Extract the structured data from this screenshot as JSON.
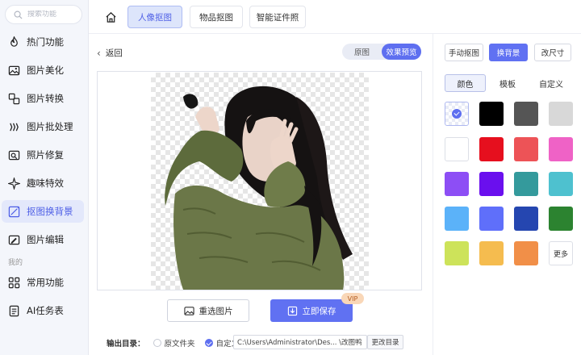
{
  "search": {
    "placeholder": "搜索功能"
  },
  "sidebar": {
    "items": [
      {
        "label": "热门功能",
        "icon": "flame-icon"
      },
      {
        "label": "图片美化",
        "icon": "image-icon"
      },
      {
        "label": "图片转换",
        "icon": "convert-icon"
      },
      {
        "label": "图片批处理",
        "icon": "batch-icon"
      },
      {
        "label": "照片修复",
        "icon": "repair-icon"
      },
      {
        "label": "趣味特效",
        "icon": "sparkle-icon"
      },
      {
        "label": "抠图换背景",
        "icon": "cutout-icon",
        "active": true
      },
      {
        "label": "图片编辑",
        "icon": "edit-icon"
      }
    ],
    "section_label": "我的",
    "my_items": [
      {
        "label": "常用功能",
        "icon": "grid-icon"
      },
      {
        "label": "AI任务表",
        "icon": "list-icon"
      }
    ]
  },
  "topbar": {
    "tabs": [
      {
        "label": "人像抠图",
        "active": true
      },
      {
        "label": "物品抠图",
        "active": false
      },
      {
        "label": "智能证件照",
        "active": false
      }
    ]
  },
  "main": {
    "back_label": "返回",
    "view_toggle": {
      "original": "原图",
      "preview": "效果预览",
      "selected": "preview"
    },
    "reselect_label": "重选图片",
    "save_label": "立即保存",
    "vip_badge": "VIP",
    "output": {
      "label": "输出目录：",
      "option_source": "原文件夹",
      "option_custom": "自定义",
      "selected": "custom",
      "path": "C:\\Users\\Administrator\\Des... \\改图鸭",
      "change_label": "更改目录"
    }
  },
  "right_panel": {
    "modes": [
      {
        "label": "手动抠图",
        "active": false
      },
      {
        "label": "换背景",
        "active": true
      },
      {
        "label": "改尺寸",
        "active": false
      }
    ],
    "color_tabs": [
      {
        "label": "颜色",
        "active": true
      },
      {
        "label": "模板",
        "active": false
      },
      {
        "label": "自定义",
        "active": false
      }
    ],
    "swatches": [
      "transparent",
      "#000000",
      "#555555",
      "#d8d8d8",
      "#ffffff",
      "#e60f1e",
      "#ed5357",
      "#ef62c6",
      "#8d4ef5",
      "#6a0fee",
      "#349a9c",
      "#4ec1cf",
      "#5bb2f9",
      "#5f6ffa",
      "#2546b0",
      "#2c8330",
      "#cde35a",
      "#f5bc4f",
      "#f18f48"
    ],
    "more_label": "更多"
  }
}
